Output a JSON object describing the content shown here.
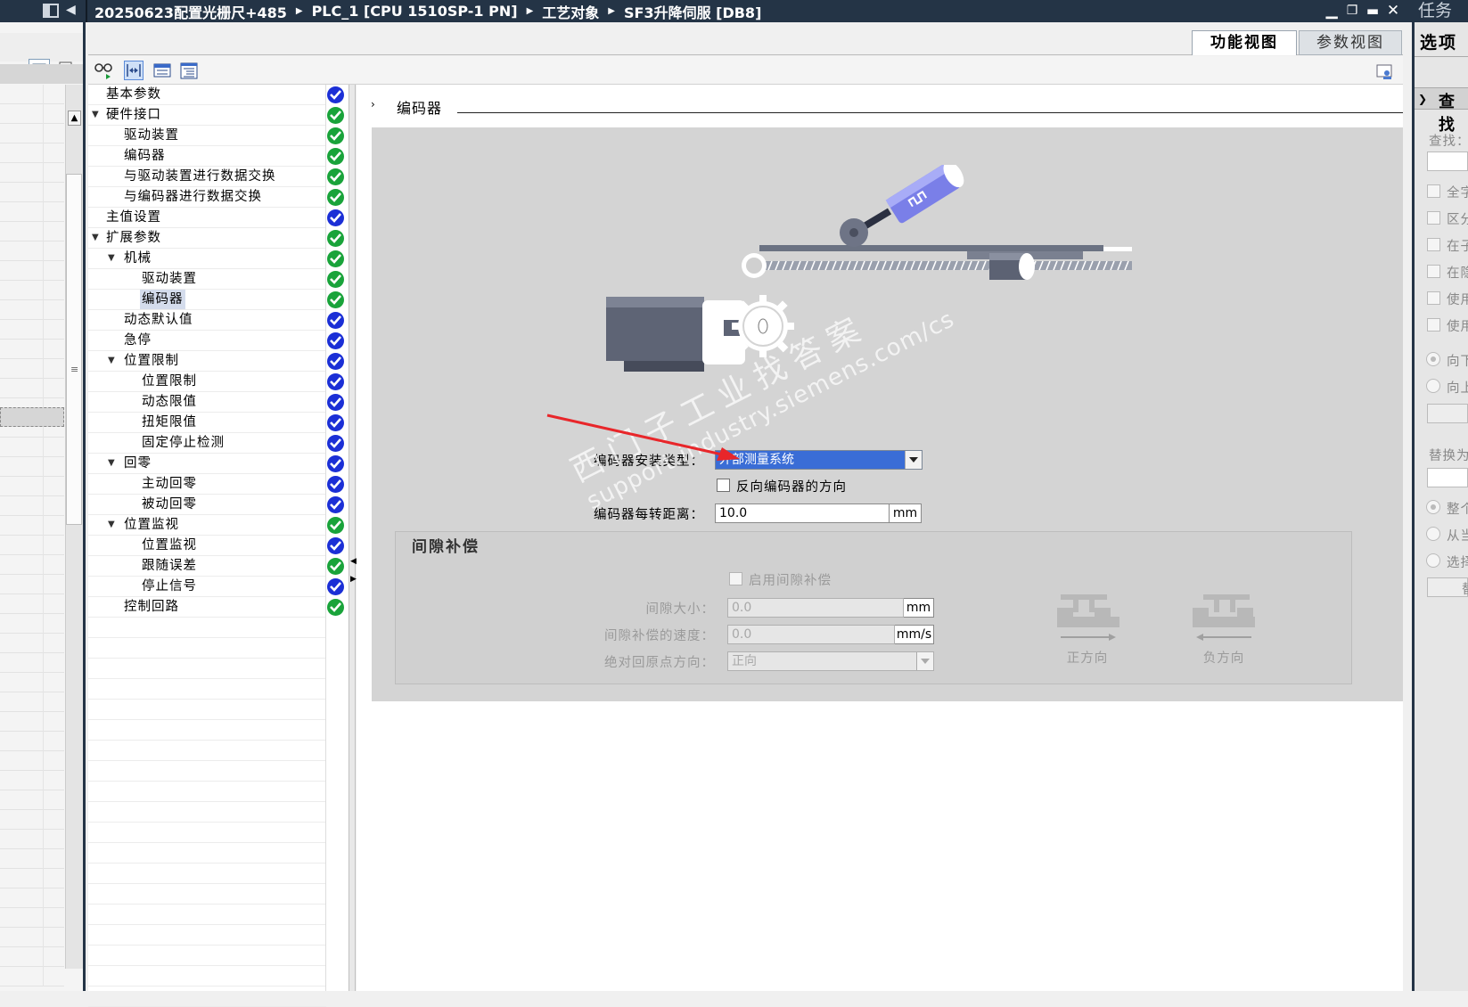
{
  "titlebar": {
    "breadcrumb": [
      "20250623配置光栅尺+485",
      "PLC_1 [CPU 1510SP-1 PN]",
      "工艺对象",
      "SF3升降伺服 [DB8]"
    ],
    "task_label": "任务"
  },
  "tabs": {
    "function_view": "功能视图",
    "parameter_view": "参数视图"
  },
  "nav": [
    {
      "label": "基本参数",
      "level": 0,
      "expander": "",
      "status": "info"
    },
    {
      "label": "硬件接口",
      "level": 0,
      "expander": "open",
      "status": "ok"
    },
    {
      "label": "驱动装置",
      "level": 1,
      "expander": "",
      "status": "ok"
    },
    {
      "label": "编码器",
      "level": 1,
      "expander": "",
      "status": "ok"
    },
    {
      "label": "与驱动装置进行数据交换",
      "level": 1,
      "expander": "",
      "status": "ok"
    },
    {
      "label": "与编码器进行数据交换",
      "level": 1,
      "expander": "",
      "status": "ok"
    },
    {
      "label": "主值设置",
      "level": 0,
      "expander": "",
      "status": "info"
    },
    {
      "label": "扩展参数",
      "level": 0,
      "expander": "open",
      "status": "ok"
    },
    {
      "label": "机械",
      "level": 1,
      "expander": "open",
      "status": "ok"
    },
    {
      "label": "驱动装置",
      "level": 2,
      "expander": "",
      "status": "ok"
    },
    {
      "label": "编码器",
      "level": 2,
      "expander": "",
      "status": "ok",
      "selected": true
    },
    {
      "label": "动态默认值",
      "level": 1,
      "expander": "",
      "status": "info"
    },
    {
      "label": "急停",
      "level": 1,
      "expander": "",
      "status": "info"
    },
    {
      "label": "位置限制",
      "level": 1,
      "expander": "open",
      "status": "info"
    },
    {
      "label": "位置限制",
      "level": 2,
      "expander": "",
      "status": "info"
    },
    {
      "label": "动态限值",
      "level": 2,
      "expander": "",
      "status": "info"
    },
    {
      "label": "扭矩限值",
      "level": 2,
      "expander": "",
      "status": "info"
    },
    {
      "label": "固定停止检测",
      "level": 2,
      "expander": "",
      "status": "info"
    },
    {
      "label": "回零",
      "level": 1,
      "expander": "open",
      "status": "info"
    },
    {
      "label": "主动回零",
      "level": 2,
      "expander": "",
      "status": "info"
    },
    {
      "label": "被动回零",
      "level": 2,
      "expander": "",
      "status": "info"
    },
    {
      "label": "位置监视",
      "level": 1,
      "expander": "open",
      "status": "ok"
    },
    {
      "label": "位置监视",
      "level": 2,
      "expander": "",
      "status": "info"
    },
    {
      "label": "跟随误差",
      "level": 2,
      "expander": "",
      "status": "ok"
    },
    {
      "label": "停止信号",
      "level": 2,
      "expander": "",
      "status": "info"
    },
    {
      "label": "控制回路",
      "level": 1,
      "expander": "",
      "status": "ok"
    }
  ],
  "section": {
    "title": "编码器",
    "encoder_mount_type": {
      "label": "编码器安装类型：",
      "value": "外部测量系统"
    },
    "invert_direction": {
      "label": "反向编码器的方向",
      "checked": false
    },
    "distance_per_rev": {
      "label": "编码器每转距离：",
      "value": "10.0",
      "unit": "mm"
    }
  },
  "backlash": {
    "title": "间隙补偿",
    "enable": {
      "label": "启用间隙补偿",
      "checked": false
    },
    "size": {
      "label": "间隙大小：",
      "value": "0.0",
      "unit": "mm"
    },
    "speed": {
      "label": "间隙补偿的速度：",
      "value": "0.0",
      "unit": "mm/s"
    },
    "abs_home_dir": {
      "label": "绝对回原点方向：",
      "value": "正向"
    },
    "positive_label": "正方向",
    "negative_label": "负方向"
  },
  "watermark": {
    "line1": "西门子工业找答案",
    "line2": "support.industry.siemens.com/cs"
  },
  "taskpane": {
    "options_title": "选项",
    "find_title": "查找",
    "find_label": "查找：",
    "checkboxes": [
      "全字",
      "区分",
      "在子",
      "在隐",
      "使用",
      "使用"
    ],
    "radios1": [
      "向下",
      "向上"
    ],
    "replace_label": "替换为",
    "radios2": [
      "整个",
      "从当",
      "选择"
    ],
    "button_label": "替"
  },
  "colors": {
    "titlebar": "#243446",
    "ok": "#19a33a",
    "info": "#1b2fd6",
    "selection": "#3a6dd6",
    "annotation_arrow": "#e8262a"
  }
}
